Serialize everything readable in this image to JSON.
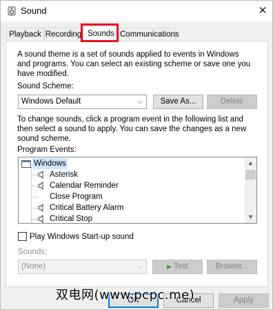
{
  "window": {
    "title": "Sound",
    "close_glyph": "✕"
  },
  "tabs": [
    {
      "label": "Playback"
    },
    {
      "label": "Recording"
    },
    {
      "label": "Sounds"
    },
    {
      "label": "Communications"
    }
  ],
  "active_tab": "Sounds",
  "highlight_color": "#e81123",
  "sounds": {
    "intro_line1": "A sound theme is a set of sounds applied to events in Windows",
    "intro_line2": "and programs.  You can select an existing scheme or save one you",
    "intro_line3": "have modified.",
    "scheme_label": "Sound Scheme:",
    "scheme_value": "Windows Default",
    "save_as_label": "Save As...",
    "delete_label": "Delete",
    "help_line1": "To change sounds, click a program event in the following list and",
    "help_line2": "then select a sound to apply.  You can save the changes as a new",
    "help_line3": "sound scheme.",
    "events_label": "Program Events:",
    "events": {
      "root": "Windows",
      "items": [
        {
          "label": "Asterisk",
          "has_sound": true
        },
        {
          "label": "Calendar Reminder",
          "has_sound": true
        },
        {
          "label": "Close Program",
          "has_sound": false
        },
        {
          "label": "Critical Battery Alarm",
          "has_sound": true
        },
        {
          "label": "Critical Stop",
          "has_sound": true
        }
      ]
    },
    "startup_label": "Play Windows Start-up sound",
    "startup_checked": false,
    "sounds_label": "Sounds:",
    "sounds_value": "(None)",
    "test_label": "Test",
    "browse_label": "Browse..."
  },
  "footer": {
    "ok_label": "OK",
    "cancel_label": "Cancel",
    "apply_label": "Apply"
  },
  "watermark": "双电网(www.pcpc.me)"
}
